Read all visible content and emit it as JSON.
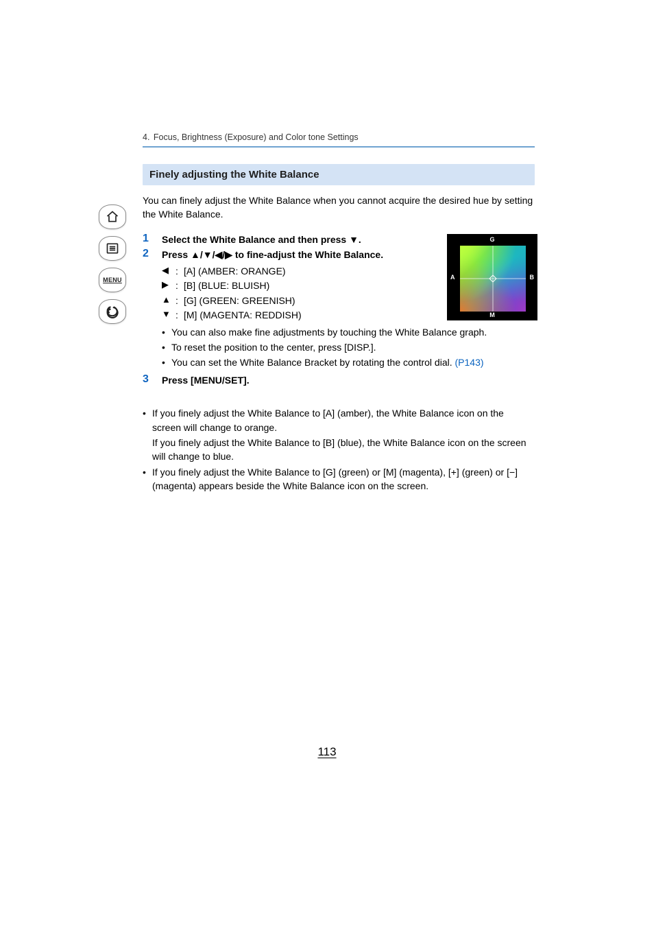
{
  "breadcrumb": {
    "section_num": "4.",
    "section_title": "Focus, Brightness (Exposure) and Color tone Settings"
  },
  "sidebar": {
    "home_name": "home-icon",
    "toc_name": "toc-icon",
    "menu_label": "MENU",
    "back_name": "back-icon"
  },
  "section_heading": "Finely adjusting the White Balance",
  "intro": "You can finely adjust the White Balance when you cannot acquire the desired hue by setting the White Balance.",
  "steps": {
    "s1": {
      "num": "1",
      "text": "Select the White Balance and then press ▼."
    },
    "s2": {
      "num": "2",
      "text": "Press ▲/▼/◀/▶ to fine-adjust the White Balance.",
      "arrows": {
        "left": {
          "sym": "◀",
          "colon": ":",
          "txt": "[A] (AMBER: ORANGE)"
        },
        "right": {
          "sym": "▶",
          "colon": ":",
          "txt": "[B] (BLUE: BLUISH)"
        },
        "up": {
          "sym": "▲",
          "colon": ":",
          "txt": "[G] (GREEN: GREENISH)"
        },
        "down": {
          "sym": "▼",
          "colon": ":",
          "txt": "[M] (MAGENTA: REDDISH)"
        }
      },
      "bullets": {
        "b1": "You can also make fine adjustments by touching the White Balance graph.",
        "b2": "To reset the position to the center, press [DISP.].",
        "b3_pre": "You can set the White Balance Bracket by rotating the control dial. ",
        "b3_link": "(P143)"
      }
    },
    "s3": {
      "num": "3",
      "text": "Press [MENU/SET]."
    }
  },
  "wb_graph": {
    "G": "G",
    "A": "A",
    "B": "B",
    "M": "M"
  },
  "notes": {
    "n1": "If you finely adjust the White Balance to [A] (amber), the White Balance icon on the screen will change to orange.",
    "n1b": "If you finely adjust the White Balance to [B] (blue), the White Balance icon on the screen will change to blue.",
    "n2": "If you finely adjust the White Balance to [G] (green) or [M] (magenta), [+] (green) or [−] (magenta) appears beside the White Balance icon on the screen."
  },
  "page_number": "113"
}
